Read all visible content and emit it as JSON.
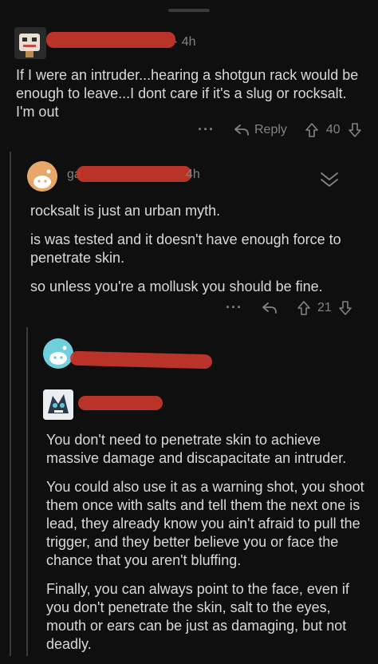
{
  "comment1": {
    "time": "· 4h",
    "text": "If I were an intruder...hearing a shotgun rack would be enough to leave...I dont care if it's a slug or rocksalt. I'm out",
    "more": "···",
    "reply_label": "Reply",
    "votes": "40"
  },
  "comment2": {
    "user_prefix": "ga",
    "time": "4h",
    "paragraphs": [
      "rocksalt is just an urban myth.",
      "is was tested and it doesn't have enough force to penetrate skin.",
      "so unless you're a mollusk you should be fine."
    ],
    "more": "···",
    "votes": "21"
  },
  "comment3": {
    "paragraphs": [
      "You don't need to penetrate skin to achieve massive damage and discapacitate an intruder.",
      "You could also use it as a warning shot, you shoot them once with salts and tell them the next one is lead, they already know you ain't afraid to pull the trigger, and they better believe you or face the chance that you aren't bluffing.",
      "Finally, you can always point to the face, even if you don't penetrate the skin, salt to the eyes, mouth or ears can be just as damaging, but not deadly."
    ]
  },
  "colors": {
    "background": "#0f0f0f",
    "text": "#d7dadc",
    "muted": "#818384",
    "redaction": "#c9362a",
    "thread_line": "#3a3a3c"
  },
  "icons": [
    "reply-arrow-icon",
    "upvote-icon",
    "downvote-icon",
    "collapse-chevron-icon",
    "more-dots-icon"
  ]
}
